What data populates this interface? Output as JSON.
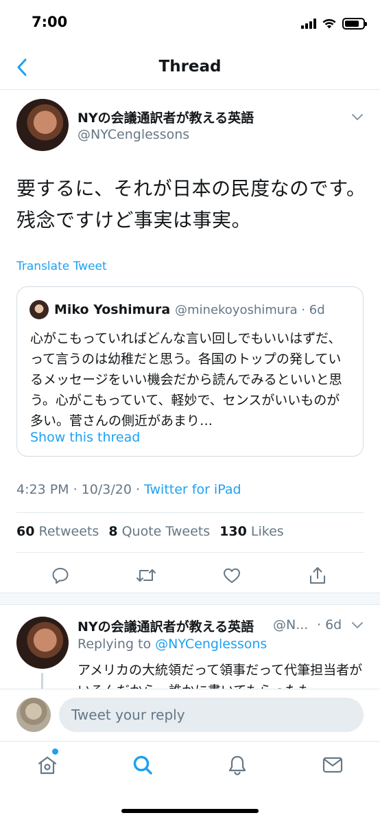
{
  "status_bar": {
    "time": "7:00"
  },
  "nav": {
    "title": "Thread"
  },
  "tweet": {
    "author_name": "NYの会議通訳者が教える英語",
    "author_handle": "@NYCenglessons",
    "text": "要するに、それが日本の民度なのです。残念ですけど事実は事実。",
    "translate_label": "Translate Tweet",
    "quote": {
      "name": "Miko Yoshimura",
      "handle_time": "@minekoyoshimura · 6d",
      "text": "心がこもっていればどんな言い回しでもいいはずだ、って言うのは幼稚だと思う。各国のトップの発しているメッセージをいい機会だから読んでみるといいと思う。心がこもっていて、軽妙で、センスがいいものが多い。菅さんの側近があまり…",
      "show_thread": "Show this thread"
    },
    "time": "4:23 PM · 10/3/20 · ",
    "source": "Twitter for iPad",
    "stats": {
      "retweets_count": "60",
      "retweets_label": "Retweets",
      "quotes_count": "8",
      "quotes_label": "Quote Tweets",
      "likes_count": "130",
      "likes_label": "Likes"
    }
  },
  "reply": {
    "author_name": "NYの会議通訳者が教える英語",
    "author_handle": "@N...",
    "time": "· 6d",
    "replying_prefix": "Replying to ",
    "replying_to": "@NYCenglessons",
    "text": "アメリカの大統領だって領事だって代筆担当者がいるんだから、誰かに書いてもらったも"
  },
  "compose": {
    "placeholder": "Tweet your reply"
  },
  "colors": {
    "accent": "#1da1f2",
    "secondary_text": "#657786",
    "divider": "#e1e8ed"
  },
  "icons": {
    "actions": [
      "reply-icon",
      "retweet-icon",
      "like-icon",
      "share-icon"
    ],
    "tabs": [
      "home-icon",
      "search-icon",
      "notifications-icon",
      "messages-icon"
    ]
  }
}
